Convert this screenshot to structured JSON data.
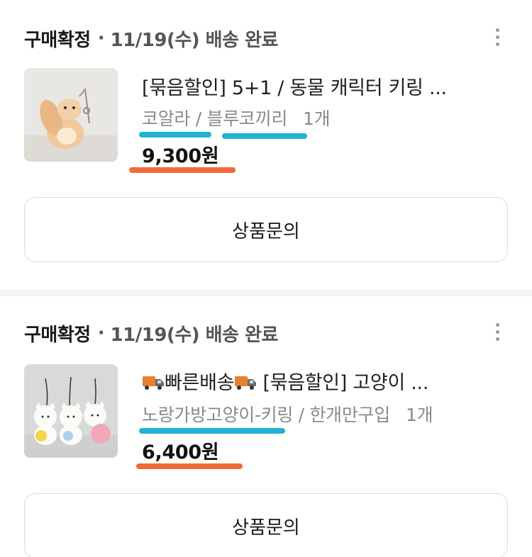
{
  "orders": [
    {
      "status": "구매확정",
      "separator": "·",
      "detail": "11/19(수) 배송 완료",
      "product_name": "[묶음할인] 5+1 / 동물 캐릭터 키링 ...",
      "option_1": "코알라",
      "option_sep": " / ",
      "option_2": "블루코끼리",
      "quantity": "1개",
      "price": "9,300원",
      "inquiry_label": "상품문의"
    },
    {
      "status": "구매확정",
      "separator": "·",
      "detail": "11/19(수) 배송 완료",
      "product_prefix": "빠른배송",
      "product_name": " [묶음할인] 고양이 ...",
      "option_1": "노랑가방고양이-키링",
      "option_sep": " / ",
      "option_2": "한개만구입",
      "quantity": "1개",
      "price": "6,400원",
      "inquiry_label": "상품문의"
    }
  ],
  "icons": {
    "more": "more-vertical-icon",
    "truck": "delivery-truck-icon"
  },
  "colors": {
    "highlight_blue": "#1fb3d1",
    "highlight_orange": "#f26a3a",
    "status_text": "#1a1a1a",
    "muted_text": "#8a8a8a"
  }
}
